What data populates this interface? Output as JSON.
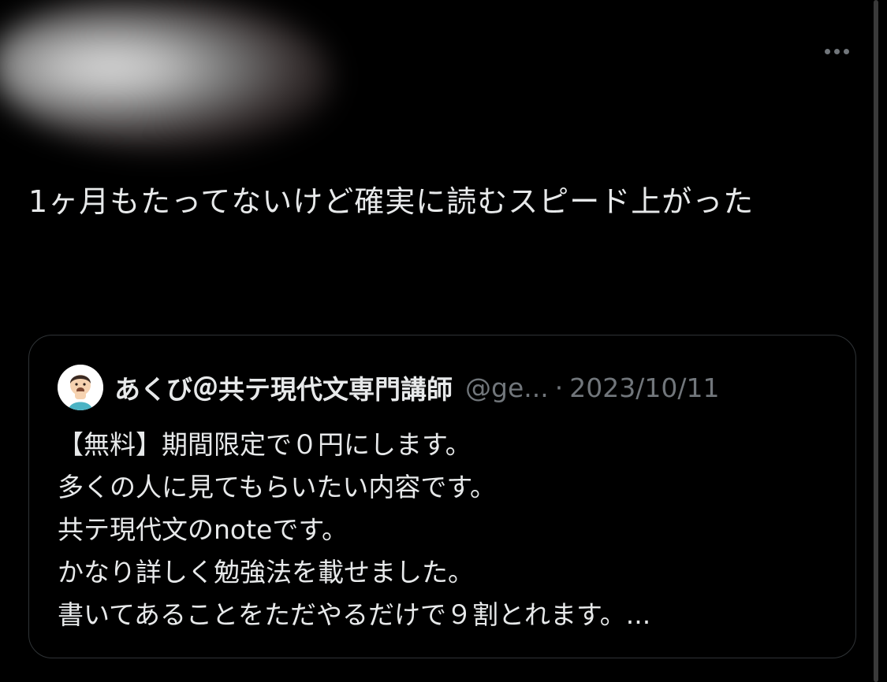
{
  "author": {
    "avatar_icon": "blurred-avatar-icon"
  },
  "actions": {
    "more_icon": "more-horizontal-icon"
  },
  "tweet": {
    "text": "1ヶ月もたってないけど確実に読むスピード上がった"
  },
  "quote": {
    "avatar_icon": "character-avatar-icon",
    "name": "あくび＠共テ現代文専門講師",
    "handle": "@ge...",
    "separator": "·",
    "date": "2023/10/11",
    "lines": [
      "【無料】期間限定で０円にします。",
      "多くの人に見てもらいたい内容です。",
      "共テ現代文のnoteです。",
      "かなり詳しく勉強法を載せました。",
      "書いてあることをただやるだけで９割とれます。..."
    ]
  },
  "colors": {
    "background": "#000000",
    "text_primary": "#e7e9ea",
    "text_secondary": "#71767b",
    "border": "#2f3336"
  }
}
